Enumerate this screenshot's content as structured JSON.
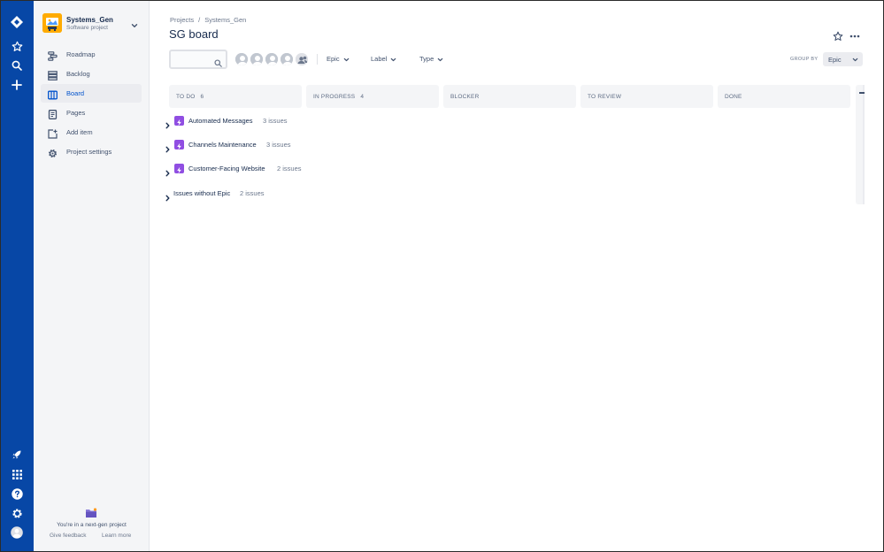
{
  "sidebar": {
    "project_name": "Systems_Gen",
    "project_type": "Software project",
    "items": [
      {
        "label": "Roadmap"
      },
      {
        "label": "Backlog"
      },
      {
        "label": "Board"
      },
      {
        "label": "Pages"
      },
      {
        "label": "Add item"
      },
      {
        "label": "Project settings"
      }
    ],
    "footer_text": "You're in a next-gen project",
    "give_feedback": "Give feedback",
    "learn_more": "Learn more"
  },
  "breadcrumbs": [
    "Projects",
    "Systems_Gen"
  ],
  "breadcrumb_separator": "/",
  "page_title": "SG board",
  "filters": {
    "search_placeholder": "",
    "epic": "Epic",
    "label": "Label",
    "type": "Type",
    "group_by_label": "GROUP BY",
    "group_by_value": "Epic"
  },
  "columns": [
    {
      "name": "TO DO",
      "count": "6"
    },
    {
      "name": "IN PROGRESS",
      "count": "4"
    },
    {
      "name": "BLOCKER",
      "count": ""
    },
    {
      "name": "TO REVIEW",
      "count": ""
    },
    {
      "name": "DONE",
      "count": ""
    }
  ],
  "epics": [
    {
      "name": "Automated Messages",
      "count": "3 issues"
    },
    {
      "name": "Channels Maintenance",
      "count": "3 issues"
    },
    {
      "name": "Customer-Facing Website",
      "count": "2 issues"
    }
  ],
  "no_epic": {
    "name": "Issues without Epic",
    "count": "2 issues"
  },
  "colors": {
    "global_nav": "#0747A6",
    "sidebar_bg": "#F4F5F7",
    "active_item": "#0052CC",
    "epic_purple": "#904EE2",
    "project_avatar": "#FFAB00"
  },
  "icons": {
    "global_nav_top": [
      "jira-logo-icon",
      "star-icon",
      "search-icon",
      "plus-icon"
    ],
    "global_nav_bottom": [
      "rocket-icon",
      "apps-grid-icon",
      "help-icon",
      "settings-icon",
      "user-avatar-icon"
    ]
  }
}
